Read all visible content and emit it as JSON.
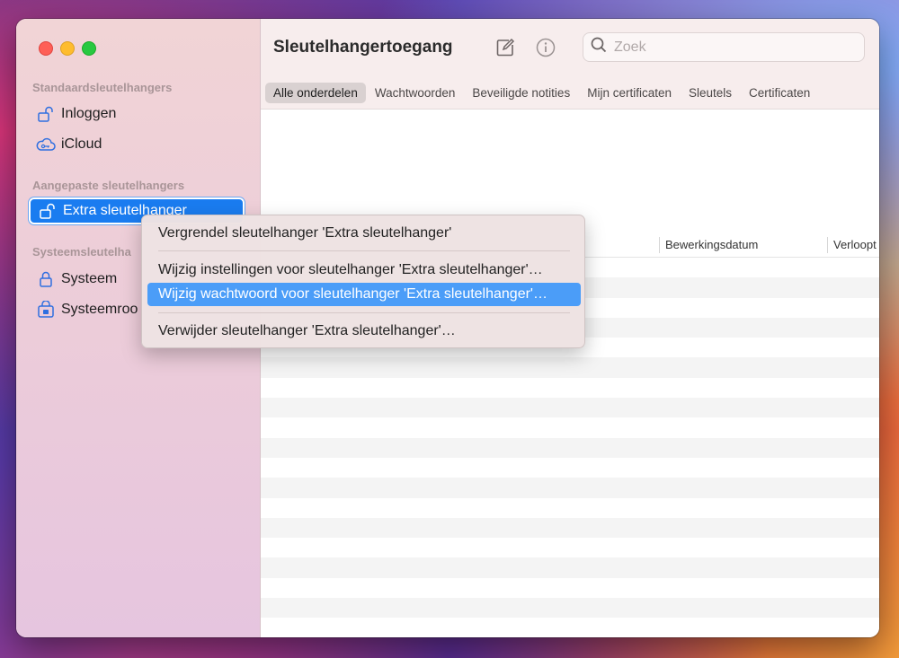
{
  "app": {
    "title": "Sleutelhangertoegang"
  },
  "sidebar": {
    "sections": [
      {
        "label": "Standaardsleutelhangers"
      },
      {
        "label": "Aangepaste sleutelhangers"
      },
      {
        "label": "Systeemsleutelha"
      }
    ],
    "items": [
      {
        "label": "Inloggen",
        "icon": "lock-open-icon"
      },
      {
        "label": "iCloud",
        "icon": "cloud-key-icon"
      },
      {
        "label": "Extra sleutelhanger",
        "icon": "lock-open-icon"
      },
      {
        "label": "Systeem",
        "icon": "lock-icon"
      },
      {
        "label": "Systeemroo",
        "icon": "lock-box-icon"
      }
    ]
  },
  "toolbar": {
    "search_placeholder": "Zoek"
  },
  "tabs": [
    {
      "label": "Alle onderdelen"
    },
    {
      "label": "Wachtwoorden"
    },
    {
      "label": "Beveiligde notities"
    },
    {
      "label": "Mijn certificaten"
    },
    {
      "label": "Sleutels"
    },
    {
      "label": "Certificaten"
    }
  ],
  "columns": [
    {
      "label": "Bewerkingsdatum"
    },
    {
      "label": "Verloopt"
    }
  ],
  "context_menu": {
    "items": [
      {
        "label": "Vergrendel sleutelhanger 'Extra sleutelhanger'"
      },
      {
        "label": "Wijzig instellingen voor sleutelhanger 'Extra sleutelhanger'…"
      },
      {
        "label": "Wijzig wachtwoord voor sleutelhanger 'Extra sleutelhanger'…"
      },
      {
        "label": "Verwijder sleutelhanger 'Extra sleutelhanger'…"
      }
    ]
  },
  "colors": {
    "accent": "#1a7cf0",
    "menu_highlight": "#4b9df8"
  }
}
